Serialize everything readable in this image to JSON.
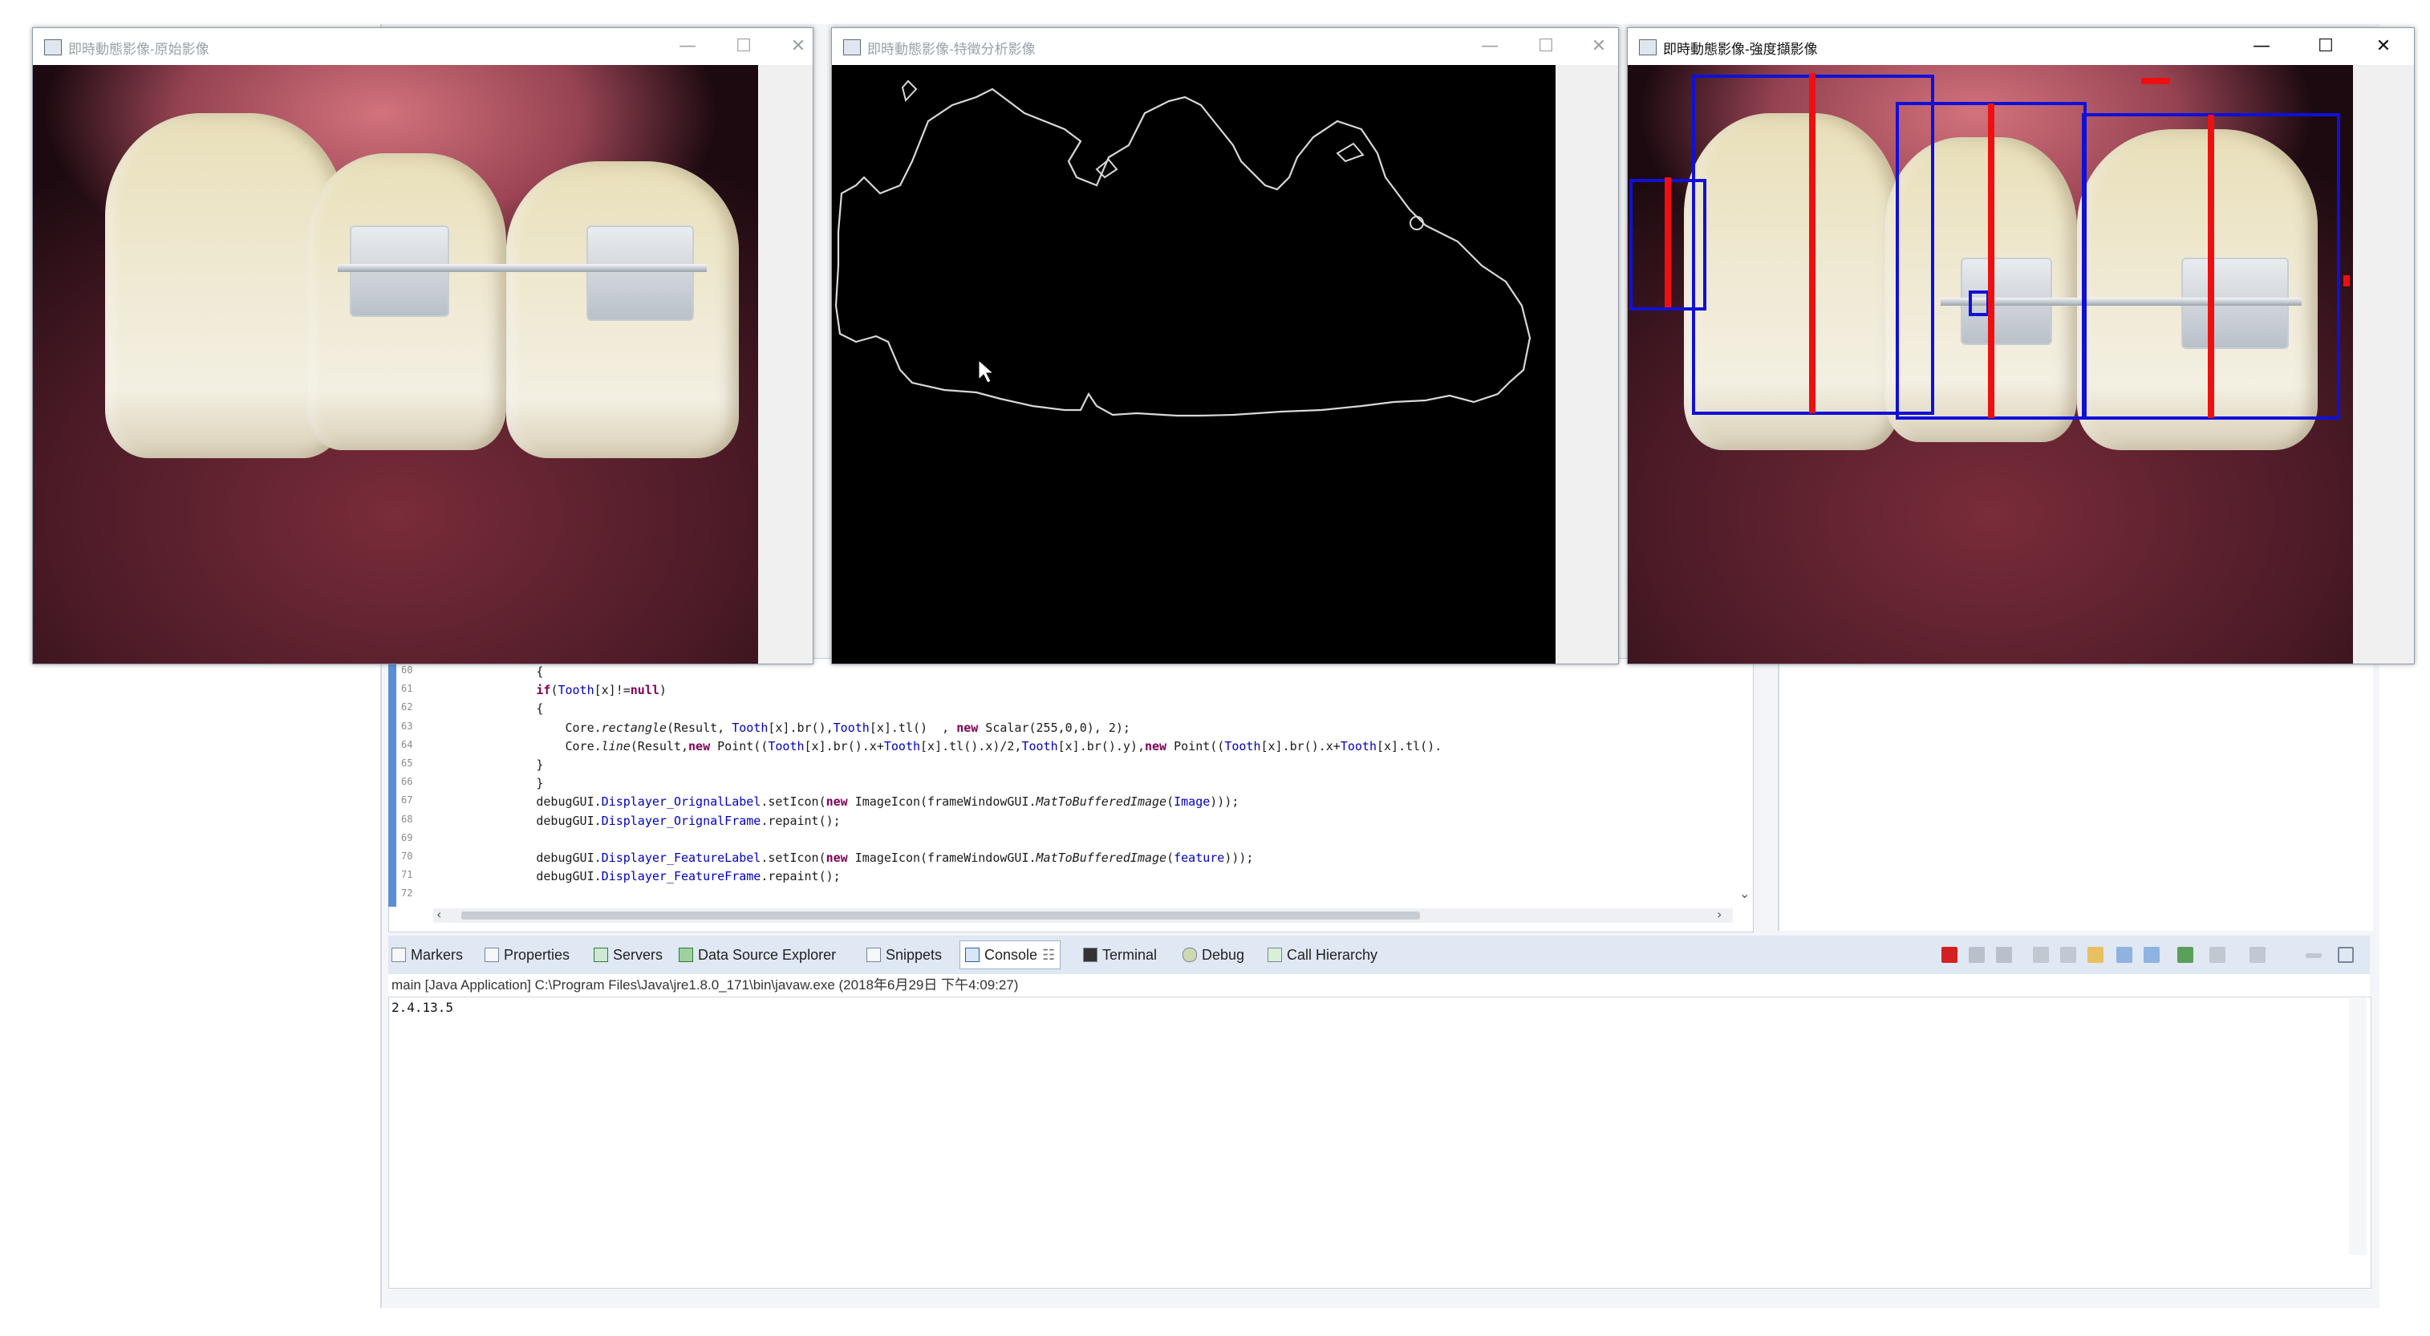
{
  "windows": {
    "original": {
      "title": "即時動態影像-原始影像"
    },
    "feature": {
      "title": "即時動態影像-特徵分析影像"
    },
    "result": {
      "title": "即時動態影像-強度擷影像"
    },
    "controls": {
      "minimize": "—",
      "maximize": "☐",
      "close": "✕"
    }
  },
  "editor": {
    "line_numbers": [
      "60",
      "61",
      "62",
      "63",
      "64",
      "65",
      "66",
      "67",
      "68",
      "69",
      "70",
      "71",
      "72"
    ],
    "lines": [
      [
        {
          "t": "            {",
          "c": ""
        }
      ],
      [
        {
          "t": "            ",
          "c": ""
        },
        {
          "t": "if",
          "c": "kw"
        },
        {
          "t": "(",
          "c": ""
        },
        {
          "t": "Tooth",
          "c": "fld"
        },
        {
          "t": "[x]!=",
          "c": ""
        },
        {
          "t": "null",
          "c": "kw"
        },
        {
          "t": ")",
          "c": ""
        }
      ],
      [
        {
          "t": "            {",
          "c": ""
        }
      ],
      [
        {
          "t": "                Core.",
          "c": ""
        },
        {
          "t": "rectangle",
          "c": "it"
        },
        {
          "t": "(Result, ",
          "c": ""
        },
        {
          "t": "Tooth",
          "c": "fld"
        },
        {
          "t": "[x].br(),",
          "c": ""
        },
        {
          "t": "Tooth",
          "c": "fld"
        },
        {
          "t": "[x].tl()  , ",
          "c": ""
        },
        {
          "t": "new",
          "c": "kw"
        },
        {
          "t": " Scalar(255,0,0), 2);",
          "c": ""
        }
      ],
      [
        {
          "t": "                Core.",
          "c": ""
        },
        {
          "t": "line",
          "c": "it"
        },
        {
          "t": "(Result,",
          "c": ""
        },
        {
          "t": "new",
          "c": "kw"
        },
        {
          "t": " Point((",
          "c": ""
        },
        {
          "t": "Tooth",
          "c": "fld"
        },
        {
          "t": "[x].br().x+",
          "c": ""
        },
        {
          "t": "Tooth",
          "c": "fld"
        },
        {
          "t": "[x].tl().x)/2,",
          "c": ""
        },
        {
          "t": "Tooth",
          "c": "fld"
        },
        {
          "t": "[x].br().y),",
          "c": ""
        },
        {
          "t": "new",
          "c": "kw"
        },
        {
          "t": " Point((",
          "c": ""
        },
        {
          "t": "Tooth",
          "c": "fld"
        },
        {
          "t": "[x].br().x+",
          "c": ""
        },
        {
          "t": "Tooth",
          "c": "fld"
        },
        {
          "t": "[x].tl().",
          "c": ""
        }
      ],
      [
        {
          "t": "            }",
          "c": ""
        }
      ],
      [
        {
          "t": "            }",
          "c": ""
        }
      ],
      [
        {
          "t": "            debugGUI.",
          "c": ""
        },
        {
          "t": "Displayer_OrignalLabel",
          "c": "fld"
        },
        {
          "t": ".setIcon(",
          "c": ""
        },
        {
          "t": "new",
          "c": "kw"
        },
        {
          "t": " ImageIcon(frameWindowGUI.",
          "c": ""
        },
        {
          "t": "MatToBufferedImage",
          "c": "it"
        },
        {
          "t": "(",
          "c": ""
        },
        {
          "t": "Image",
          "c": "fld"
        },
        {
          "t": ")));",
          "c": ""
        }
      ],
      [
        {
          "t": "            debugGUI.",
          "c": ""
        },
        {
          "t": "Displayer_OrignalFrame",
          "c": "fld"
        },
        {
          "t": ".repaint();",
          "c": ""
        }
      ],
      [
        {
          "t": "",
          "c": ""
        }
      ],
      [
        {
          "t": "            debugGUI.",
          "c": ""
        },
        {
          "t": "Displayer_FeatureLabel",
          "c": "fld"
        },
        {
          "t": ".setIcon(",
          "c": ""
        },
        {
          "t": "new",
          "c": "kw"
        },
        {
          "t": " ImageIcon(frameWindowGUI.",
          "c": ""
        },
        {
          "t": "MatToBufferedImage",
          "c": "it"
        },
        {
          "t": "(",
          "c": ""
        },
        {
          "t": "feature",
          "c": "fld"
        },
        {
          "t": ")));",
          "c": ""
        }
      ],
      [
        {
          "t": "            debugGUI.",
          "c": ""
        },
        {
          "t": "Displayer_FeatureFrame",
          "c": "fld"
        },
        {
          "t": ".repaint();",
          "c": ""
        }
      ],
      [
        {
          "t": "",
          "c": ""
        }
      ]
    ]
  },
  "views": {
    "tabs": [
      "Markers",
      "Properties",
      "Servers",
      "Data Source Explorer",
      "Snippets",
      "Console",
      "Terminal",
      "Debug",
      "Call Hierarchy"
    ],
    "active_tab": "Console",
    "active_marker": "☷"
  },
  "console": {
    "launch": "main [Java Application] C:\\Program Files\\Java\\jre1.8.0_171\\bin\\javaw.exe (2018年6月29日 下午4:09:27)",
    "output": "2.4.13.5"
  },
  "colors": {
    "box": "#1010d8",
    "midline": "#ee1010",
    "contour": "#d8d8d8"
  }
}
